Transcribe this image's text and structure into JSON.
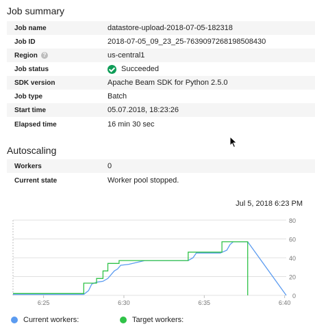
{
  "job_summary": {
    "title": "Job summary",
    "rows": [
      {
        "key": "Job name",
        "value": "datastore-upload-2018-07-05-182318"
      },
      {
        "key": "Job ID",
        "value": "2018-07-05_09_23_25-7639097268198508430"
      },
      {
        "key": "Region",
        "value": "us-central1",
        "help_icon": "help-icon"
      },
      {
        "key": "Job status",
        "value": "Succeeded",
        "status_icon": "check-circle-icon",
        "status_color": "#0f9d58"
      },
      {
        "key": "SDK version",
        "value": "Apache Beam SDK for Python 2.5.0"
      },
      {
        "key": "Job type",
        "value": "Batch"
      },
      {
        "key": "Start time",
        "value": "05.07.2018, 18:23:26"
      },
      {
        "key": "Elapsed time",
        "value": "16 min 30 sec"
      }
    ]
  },
  "autoscaling": {
    "title": "Autoscaling",
    "rows": [
      {
        "key": "Workers",
        "value": "0"
      },
      {
        "key": "Current state",
        "value": "Worker pool stopped."
      }
    ]
  },
  "chart": {
    "timestamp": "Jul 5, 2018 6:23 PM",
    "legend_current": "Current workers:",
    "legend_target": "Target workers:",
    "color_current": "#5b9bf0",
    "color_target": "#2fc247"
  },
  "chart_data": {
    "type": "line",
    "x_tick_labels": [
      "6:25",
      "6:30",
      "6:35",
      "6:40"
    ],
    "x_ticks_min": [
      25,
      30,
      35,
      40
    ],
    "y_tick_labels": [
      "0",
      "20",
      "40",
      "60",
      "80"
    ],
    "ylim": [
      0,
      80
    ],
    "xlim": [
      23.1,
      40.1
    ],
    "grid": true,
    "series": [
      {
        "name": "Current workers:",
        "color": "#5b9bf0",
        "points": [
          [
            23.1,
            1
          ],
          [
            27.5,
            1
          ],
          [
            27.8,
            5
          ],
          [
            28.0,
            12
          ],
          [
            28.3,
            14
          ],
          [
            28.7,
            15
          ],
          [
            29.0,
            18
          ],
          [
            29.4,
            26
          ],
          [
            29.6,
            28
          ],
          [
            29.8,
            32
          ],
          [
            30.3,
            33
          ],
          [
            30.8,
            35
          ],
          [
            31.3,
            37
          ],
          [
            34.0,
            37
          ],
          [
            34.3,
            40
          ],
          [
            34.5,
            45
          ],
          [
            36.0,
            45
          ],
          [
            36.4,
            48
          ],
          [
            36.6,
            54
          ],
          [
            36.8,
            57
          ],
          [
            37.7,
            57
          ],
          [
            40.1,
            0
          ]
        ]
      },
      {
        "name": "Target workers:",
        "color": "#2fc247",
        "points": [
          [
            23.1,
            2
          ],
          [
            27.5,
            2
          ],
          [
            27.5,
            13
          ],
          [
            28.3,
            13
          ],
          [
            28.3,
            18
          ],
          [
            28.7,
            18
          ],
          [
            28.7,
            26
          ],
          [
            29.0,
            26
          ],
          [
            29.0,
            34
          ],
          [
            29.7,
            34
          ],
          [
            29.7,
            37
          ],
          [
            34.0,
            37
          ],
          [
            34.0,
            46
          ],
          [
            36.1,
            46
          ],
          [
            36.1,
            57
          ],
          [
            37.7,
            57
          ],
          [
            37.7,
            0
          ]
        ]
      }
    ]
  }
}
